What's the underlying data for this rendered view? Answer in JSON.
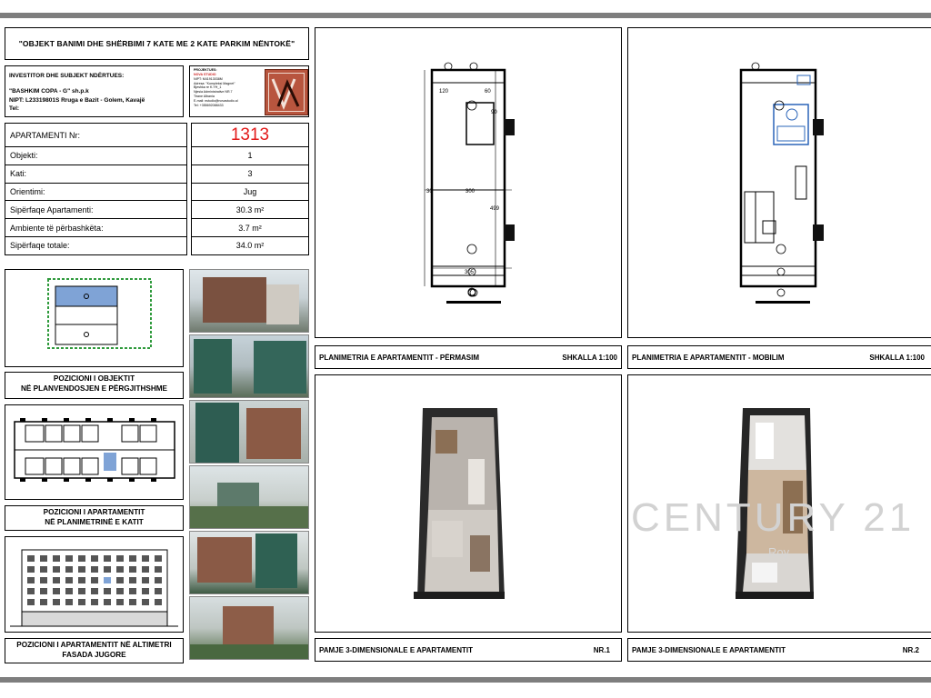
{
  "title": "\"OBJEKT BANIMI DHE SHËRBIMI 7 KATE ME 2 KATE PARKIM NËNTOKË\"",
  "investor": {
    "heading": "INVESTITOR DHE SUBJEKT NDËRTUES:",
    "name": "\"BASHKIM COPA - G\" sh.p.k",
    "nipt": "NIPT: L23319801S Rruga e Bazit - Golem, Kavajë",
    "tel": "Tel:"
  },
  "studio": {
    "heading": "PROJEKTUES:",
    "lines": [
      "NOVA STUDIO",
      "NIPT: M41913038M",
      "Adresa: \"Kompleksi Magnet\"",
      "Bjeshka re K.YH_1",
      "Njesia Administrative NR.7",
      "Tirane Albania",
      "E-mail: nstudio@novastudio.al",
      "Tel: +355692088433"
    ]
  },
  "info_rows": [
    {
      "label": "APARTAMENTI Nr:",
      "value": "1313"
    },
    {
      "label": "Objekti:",
      "value": "1"
    },
    {
      "label": "Kati:",
      "value": "3"
    },
    {
      "label": "Orientimi:",
      "value": "Jug"
    },
    {
      "label": "Sipërfaqe Apartamenti:",
      "value": "30.3 m²"
    },
    {
      "label": "Ambiente të përbashkëta:",
      "value": "3.7 m²"
    },
    {
      "label": "Sipërfaqe totale:",
      "value": "34.0 m²"
    }
  ],
  "labels": {
    "object_position": "POZICIONI I OBJEKTIT\nNË PLANVENDOSJEN E PËRGJITHSHME",
    "floor_position": "POZICIONI I APARTAMENTIT\nNË PLANIMETRINË E KATIT",
    "elevation_position": "POZICIONI I APARTAMENTIT NË ALTIMETRI\nFASADA JUGORE"
  },
  "dimensions": {
    "d120": "120",
    "d60": "60",
    "d300": "300",
    "d30": "30",
    "d305": "305",
    "d499": "499",
    "d90": "90"
  },
  "panels": {
    "p1": {
      "caption": "PLANIMETRIA E APARTAMENTIT - PËRMASIM",
      "scale": "SHKALLA 1:100"
    },
    "p2": {
      "caption": "PLANIMETRIA E APARTAMENTIT - MOBILIM",
      "scale": "SHKALLA 1:100"
    },
    "p3": {
      "caption": "PAMJE 3-DIMENSIONALE E APARTAMENTIT",
      "nr": "NR.1"
    },
    "p4": {
      "caption": "PAMJE 3-DIMENSIONALE E APARTAMENTIT",
      "nr": "NR.2"
    }
  },
  "watermark": {
    "text": "CENTURY 21",
    "sub": "Roy"
  },
  "colors": {
    "accent": "#e21a1a",
    "frame": "#7e7e7e",
    "site_building": "#7fa3d6",
    "site_border": "#2f9a3c"
  }
}
